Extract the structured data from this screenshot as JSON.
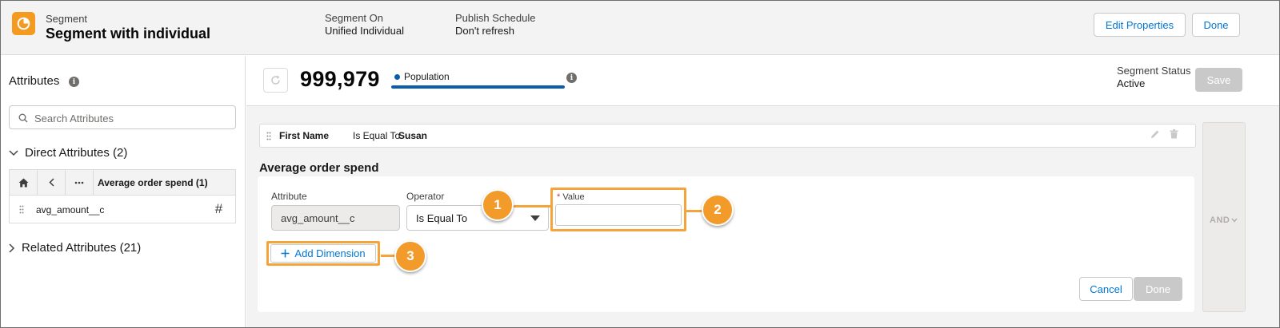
{
  "header": {
    "object_type": "Segment",
    "title": "Segment with individual",
    "segment_on_label": "Segment On",
    "segment_on_value": "Unified Individual",
    "publish_label": "Publish Schedule",
    "publish_value": "Don't refresh",
    "edit_button": "Edit Properties",
    "done_button": "Done",
    "accent_color": "#f49a1f"
  },
  "sidebar": {
    "title": "Attributes",
    "search_placeholder": "Search Attributes",
    "direct_section": "Direct Attributes (2)",
    "breadcrumb_label": "Average order spend (1)",
    "attributes": [
      {
        "name": "avg_amount__c",
        "type_icon": "#"
      }
    ],
    "related_section": "Related Attributes (21)"
  },
  "population": {
    "count": "999,979",
    "label": "Population",
    "status_label": "Segment Status",
    "status_value": "Active",
    "save_button": "Save",
    "bar_fill_fraction": 1.0,
    "bar_color": "#0b5cab"
  },
  "filters": [
    {
      "field": "First Name",
      "operator": "Is Equal To",
      "value": "Susan"
    }
  ],
  "group": {
    "title": "Average order spend",
    "attribute_label": "Attribute",
    "attribute_value": "avg_amount__c",
    "operator_label": "Operator",
    "operator_value": "Is Equal To",
    "value_required_mark": "*",
    "value_label": "Value",
    "value_input": "",
    "add_dimension": "Add Dimension",
    "cancel_button": "Cancel",
    "done_button": "Done"
  },
  "logic": {
    "and_label": "AND"
  },
  "callouts": [
    "1",
    "2",
    "3"
  ],
  "callout_color": "#f29b2a"
}
